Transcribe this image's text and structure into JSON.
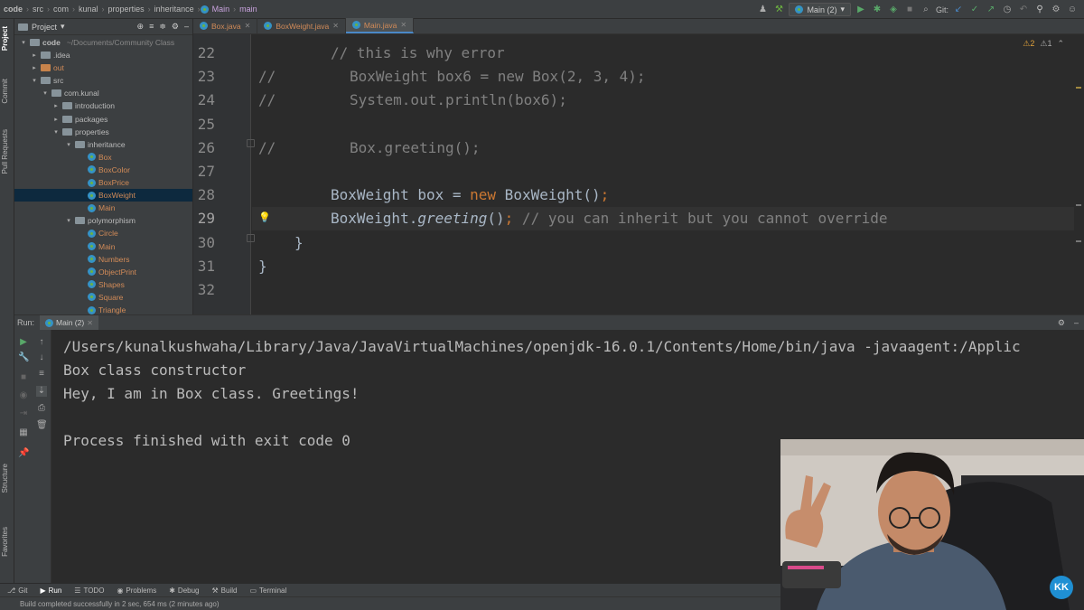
{
  "breadcrumb": [
    "code",
    "src",
    "com",
    "kunal",
    "properties",
    "inheritance",
    "Main",
    "main"
  ],
  "toolbar_right": {
    "run_config": "Main (2)",
    "git_label": "Git:"
  },
  "left_strip": [
    "Project",
    "Commit",
    "Pull Requests",
    "Structure",
    "Favorites"
  ],
  "project_panel": {
    "title": "Project",
    "root": "code",
    "root_path": "~/Documents/Community Class",
    "tree": [
      {
        "label": ".idea",
        "type": "folder"
      },
      {
        "label": "out",
        "type": "folder-orange"
      },
      {
        "label": "src",
        "type": "folder"
      },
      {
        "label": "com.kunal",
        "type": "package"
      },
      {
        "label": "introduction",
        "type": "package"
      },
      {
        "label": "packages",
        "type": "package"
      },
      {
        "label": "properties",
        "type": "package"
      },
      {
        "label": "inheritance",
        "type": "package"
      },
      {
        "label": "Box",
        "type": "class"
      },
      {
        "label": "BoxColor",
        "type": "class"
      },
      {
        "label": "BoxPrice",
        "type": "class"
      },
      {
        "label": "BoxWeight",
        "type": "class",
        "selected": true
      },
      {
        "label": "Main",
        "type": "class"
      },
      {
        "label": "polymorphism",
        "type": "package"
      },
      {
        "label": "Circle",
        "type": "class"
      },
      {
        "label": "Main",
        "type": "class"
      },
      {
        "label": "Numbers",
        "type": "class"
      },
      {
        "label": "ObjectPrint",
        "type": "class"
      },
      {
        "label": "Shapes",
        "type": "class"
      },
      {
        "label": "Square",
        "type": "class"
      },
      {
        "label": "Triangle",
        "type": "class"
      }
    ]
  },
  "editor": {
    "tabs": [
      {
        "label": "Box.java",
        "active": false
      },
      {
        "label": "BoxWeight.java",
        "active": false
      },
      {
        "label": "Main.java",
        "active": true
      }
    ],
    "warnings": {
      "warn_count": "2",
      "weak_count": "1"
    },
    "lines": [
      {
        "num": "22",
        "text": "// this is why error"
      },
      {
        "num": "23",
        "text": "//        BoxWeight box6 = new Box(2, 3, 4);"
      },
      {
        "num": "24",
        "text": "//        System.out.println(box6);"
      },
      {
        "num": "25",
        "text": ""
      },
      {
        "num": "26",
        "text": "//        Box.greeting();"
      },
      {
        "num": "27",
        "text": ""
      },
      {
        "num": "28",
        "text": "BoxWeight box = new BoxWeight();"
      },
      {
        "num": "29",
        "text": "BoxWeight.greeting(); // you can inherit but you cannot override"
      },
      {
        "num": "30",
        "text": "}"
      },
      {
        "num": "31",
        "text": "}"
      },
      {
        "num": "32",
        "text": ""
      }
    ],
    "tokens": {
      "l22": "// this is why error",
      "l23_c": "//",
      "l23_t": "BoxWeight box6 = new Box(2, 3, 4);",
      "l24_c": "//",
      "l24_t": "System.out.println(box6);",
      "l26_c": "//",
      "l26_t": "Box.greeting();",
      "l28_a": "BoxWeight ",
      "l28_b": "box",
      "l28_c": " = ",
      "l28_d": "new",
      "l28_e": " BoxWeight()",
      "l28_f": ";",
      "l29_a": "BoxWeight.",
      "l29_b": "greeting",
      "l29_c": "()",
      "l29_d": ";",
      "l29_e": " // you can inherit but you cannot override",
      "l30": "}",
      "l31": "}"
    }
  },
  "run_panel": {
    "label": "Run:",
    "tab": "Main (2)",
    "output": [
      "/Users/kunalkushwaha/Library/Java/JavaVirtualMachines/openjdk-16.0.1/Contents/Home/bin/java -javaagent:/Applic",
      "Box class constructor",
      "Hey, I am in Box class. Greetings!",
      "",
      "Process finished with exit code 0"
    ]
  },
  "tool_windows": [
    "Git",
    "Run",
    "TODO",
    "Problems",
    "Debug",
    "Build",
    "Terminal"
  ],
  "status": "Build completed successfully in 2 sec, 654 ms (2 minutes ago)",
  "webcam": {
    "badge": "KK"
  },
  "colors": {
    "keyword": "#cc7832",
    "comment": "#808080",
    "class_name": "#d28b58",
    "accent": "#4a88c7"
  }
}
